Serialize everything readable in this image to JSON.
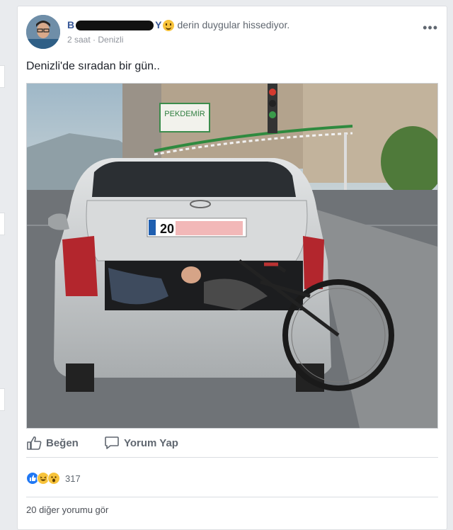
{
  "post": {
    "author_first": "B",
    "author_last": "Y",
    "feeling": "derin duygular hissediyor.",
    "time": "2 saat",
    "location": "Denizli",
    "text": "Denizli'de sıradan bir gün..",
    "photo": {
      "sign_text": "PEKDEMİR",
      "plate_text": "20"
    }
  },
  "actions": {
    "like_label": "Beğen",
    "comment_label": "Yorum Yap"
  },
  "reactions": {
    "count": "317",
    "types": [
      "like-icon",
      "haha-icon",
      "wow-icon"
    ]
  },
  "comments": {
    "more_label": "20 diğer yorumu gör"
  },
  "colors": {
    "link": "#385898",
    "like_blue": "#2078f4",
    "background": "#e9ebee"
  }
}
